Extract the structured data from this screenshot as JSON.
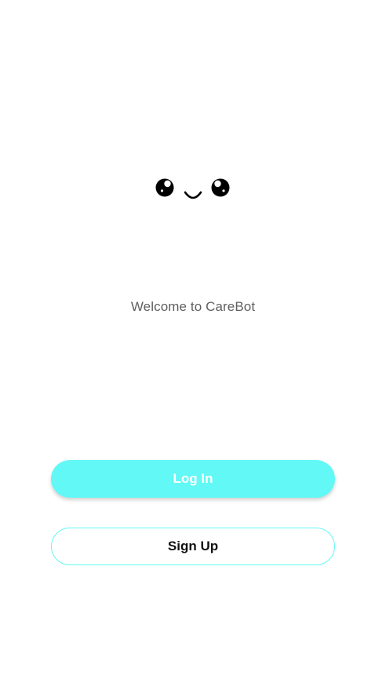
{
  "app": {
    "welcome_text": "Welcome to CareBot"
  },
  "mascot": {
    "icon": "smiley-face-icon"
  },
  "actions": {
    "login_label": "Log In",
    "signup_label": "Sign Up"
  },
  "colors": {
    "accent": "#62f8f6",
    "background": "#ffffff",
    "welcome_text": "#5f5f5f",
    "signup_text": "#111111"
  }
}
